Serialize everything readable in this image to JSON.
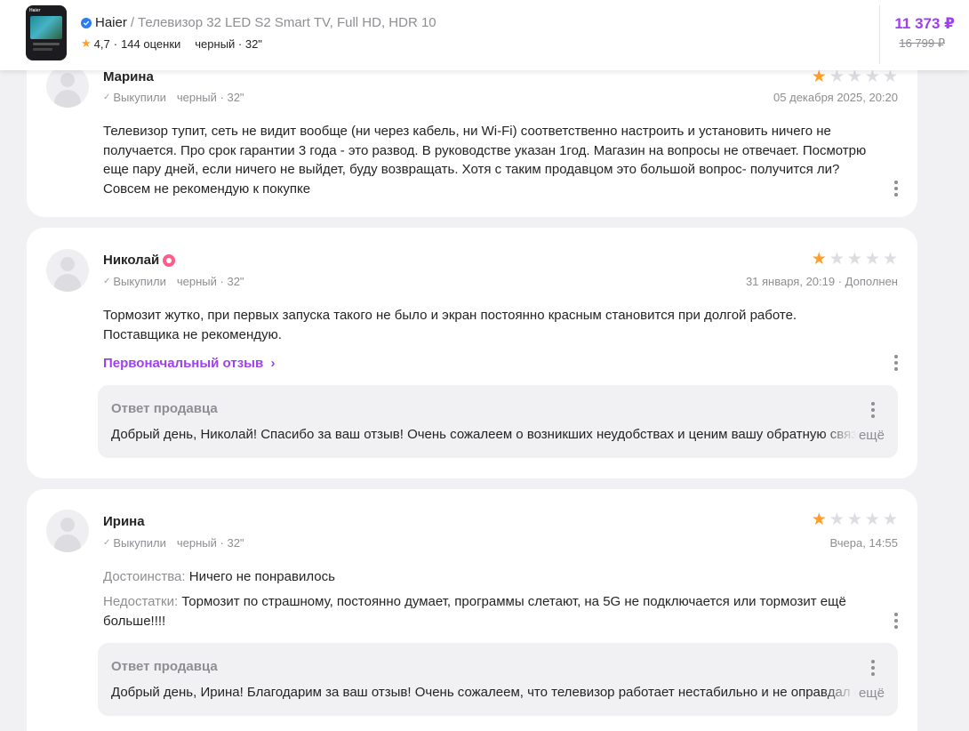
{
  "product": {
    "brand": "Haier",
    "separator": "/",
    "name": "Телевизор 32 LED S2 Smart TV, Full HD, HDR 10",
    "rating": "4,7",
    "reviews_count": "144 оценки",
    "variant": "черный · 32\"",
    "price": "11 373 ₽",
    "old_price": "16 799 ₽",
    "thumb_brand": "Haier"
  },
  "reviews": [
    {
      "author": "Марина",
      "purchase_label": "Выкупили",
      "variant": "черный · 32\"",
      "stars": 1,
      "date": "05 декабря 2025, 20:20",
      "text": "Телевизор тупит, сеть не видит вообще (ни через кабель, ни Wi-Fi) соответственно настроить и установить ничего не получается. Про срок гарантии 3 года - это развод. В руководстве указан 1год. Магазин на вопросы не отвечает. Посмотрю еще пару дней, если ничего не выйдет, буду возвращать. Хотя с таким продавцом это большой вопрос- получится ли? Совсем не рекомендую к покупке"
    },
    {
      "author": "Николай",
      "purchase_label": "Выкупили",
      "variant": "черный · 32\"",
      "stars": 1,
      "date": "31 января, 20:19 · Дополнен",
      "text": "Тормозит жутко, при первых запуска такого не было и экран постоянно красным становится при долгой работе. Поставщика не рекомендую.",
      "original_link": "Первоначальный отзыв",
      "seller_reply": {
        "title": "Ответ продавца",
        "text": "Добрый день, Николай! Спасибо за ваш отзыв! Очень сожалеем о возникших неудобствах и ценим вашу обратную связь.",
        "more": "ещё"
      }
    },
    {
      "author": "Ирина",
      "purchase_label": "Выкупили",
      "variant": "черный · 32\"",
      "stars": 1,
      "date": "Вчера, 14:55",
      "pros_label": "Достоинства:",
      "pros": "Ничего не понравилось",
      "cons_label": "Недостатки:",
      "cons": "Тормозит по страшному, постоянно думает, программы слетают, на 5G не подключается или тормозит ещё больше!!!!",
      "seller_reply": {
        "title": "Ответ продавца",
        "text": "Добрый день, Ирина! Благодарим за ваш отзыв! Очень сожалеем, что телевизор работает нестабильно и не оправдал ожиданий.",
        "more": "ещё"
      }
    }
  ],
  "colors": {
    "accent": "#9e3ff0",
    "star": "#ff9e2c",
    "muted": "#8e8e93"
  }
}
